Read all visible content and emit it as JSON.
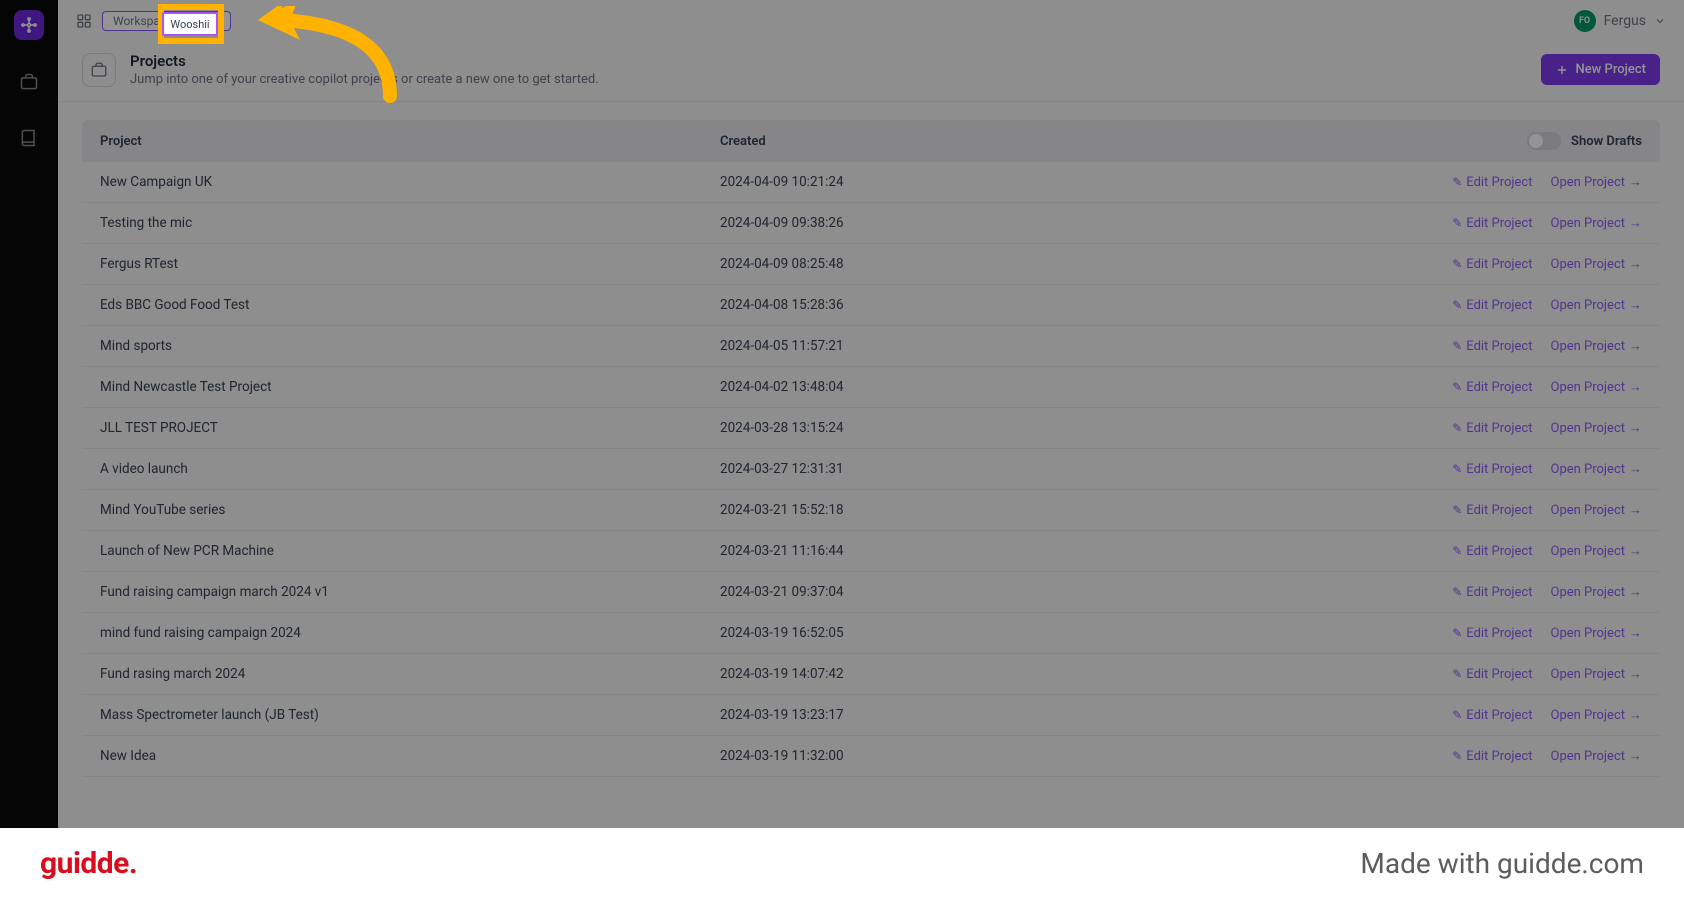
{
  "topbar": {
    "workspace_label": "Workspace:",
    "workspace_name": "Wooshii",
    "user_name": "Fergus",
    "user_initials": "FO"
  },
  "header": {
    "title": "Projects",
    "subtitle": "Jump into one of your creative copilot projects or create a new one to get started.",
    "new_btn": "New Project"
  },
  "table": {
    "col_project": "Project",
    "col_created": "Created",
    "show_drafts": "Show Drafts",
    "edit_label": "Edit Project",
    "open_label": "Open Project",
    "rows": [
      {
        "name": "New Campaign UK",
        "created": "2024-04-09 10:21:24"
      },
      {
        "name": "Testing the mic",
        "created": "2024-04-09 09:38:26"
      },
      {
        "name": "Fergus RTest",
        "created": "2024-04-09 08:25:48"
      },
      {
        "name": "Eds BBC Good Food Test",
        "created": "2024-04-08 15:28:36"
      },
      {
        "name": "Mind sports",
        "created": "2024-04-05 11:57:21"
      },
      {
        "name": "Mind Newcastle Test Project",
        "created": "2024-04-02 13:48:04"
      },
      {
        "name": "JLL TEST PROJECT",
        "created": "2024-03-28 13:15:24"
      },
      {
        "name": "A video launch",
        "created": "2024-03-27 12:31:31"
      },
      {
        "name": "Mind YouTube series",
        "created": "2024-03-21 15:52:18"
      },
      {
        "name": "Launch of New PCR Machine",
        "created": "2024-03-21 11:16:44"
      },
      {
        "name": "Fund raising campaign march 2024 v1",
        "created": "2024-03-21 09:37:04"
      },
      {
        "name": "mind fund raising campaign 2024",
        "created": "2024-03-19 16:52:05"
      },
      {
        "name": "Fund rasing march 2024",
        "created": "2024-03-19 14:07:42"
      },
      {
        "name": "Mass Spectrometer launch (JB Test)",
        "created": "2024-03-19 13:23:17"
      },
      {
        "name": "New Idea",
        "created": "2024-03-19 11:32:00"
      }
    ]
  },
  "annotation": {
    "highlight_text": "Wooshii"
  },
  "banner": {
    "brand": "guidde.",
    "made": "Made with guidde.com"
  },
  "colors": {
    "accent": "#7c3aed",
    "highlight": "#ffb300",
    "brand_red": "#d90d1e"
  }
}
